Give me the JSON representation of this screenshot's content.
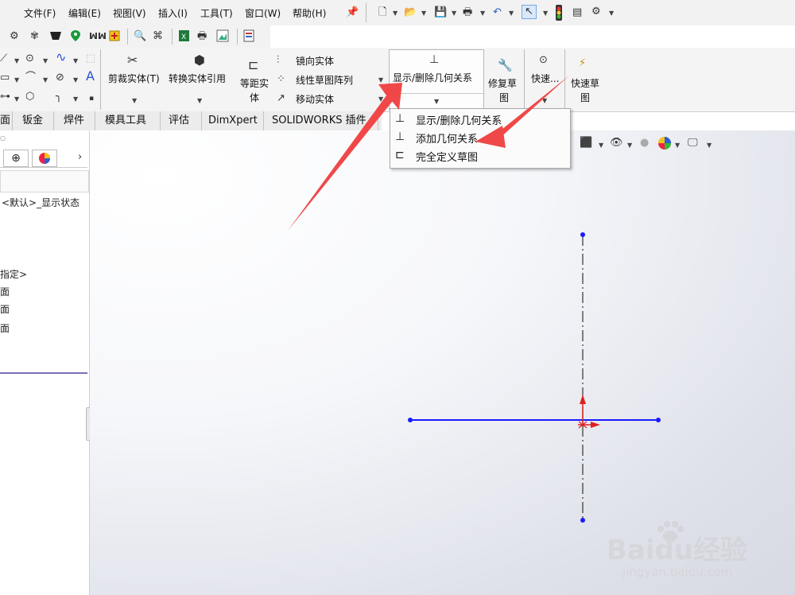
{
  "menu": {
    "items": [
      "文件(F)",
      "编辑(E)",
      "视图(V)",
      "插入(I)",
      "工具(T)",
      "窗口(W)",
      "帮助(H)"
    ]
  },
  "commands": {
    "trim": "剪裁实体(T)",
    "convert": "转换实体引用",
    "offset_l1": "等距实",
    "offset_l2": "体",
    "mirror": "镜向实体",
    "linear_pattern": "线性草图阵列",
    "move": "移动实体",
    "relations": "显示/删除几何关系",
    "repair_l1": "修复草",
    "repair_l2": "图",
    "quick_snap": "快速...",
    "rapid_l1": "快速草",
    "rapid_l2": "图"
  },
  "tabs": [
    "面",
    "钣金",
    "焊件",
    "模具工具",
    "评估",
    "DimXpert",
    "SOLIDWORKS 插件"
  ],
  "left_panel": {
    "config_text": "<默认>_显示状态",
    "item_origin": "指定>",
    "plane_1": "面",
    "plane_2": "面",
    "plane_3": "面"
  },
  "dropdown": {
    "items": [
      "显示/删除几何关系",
      "添加几何关系",
      "完全定义草图"
    ]
  },
  "watermark": {
    "brand": "Baidu经验",
    "url": "jingyan.baidu.com"
  },
  "colors": {
    "sketch_line": "#1a1aff",
    "centerline": "#333333",
    "origin": "#e02020",
    "arrow": "#f04848"
  }
}
